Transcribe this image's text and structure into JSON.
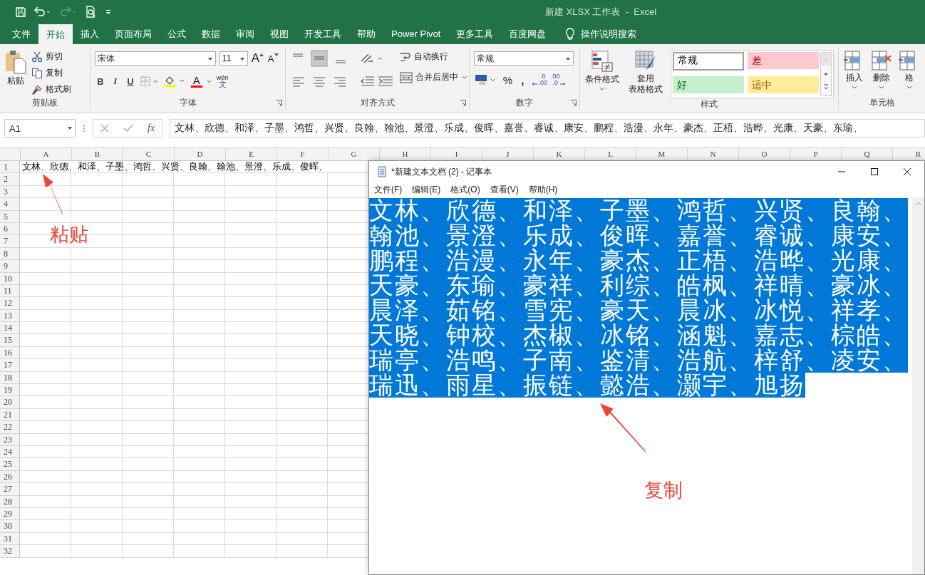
{
  "window": {
    "title": "新建 XLSX 工作表  -  Excel"
  },
  "ribbon_tabs": [
    {
      "label": "文件",
      "selected": false
    },
    {
      "label": "开始",
      "selected": true
    },
    {
      "label": "插入",
      "selected": false
    },
    {
      "label": "页面布局",
      "selected": false
    },
    {
      "label": "公式",
      "selected": false
    },
    {
      "label": "数据",
      "selected": false
    },
    {
      "label": "审阅",
      "selected": false
    },
    {
      "label": "视图",
      "selected": false
    },
    {
      "label": "开发工具",
      "selected": false
    },
    {
      "label": "帮助",
      "selected": false
    },
    {
      "label": "Power Pivot",
      "selected": false
    },
    {
      "label": "更多工具",
      "selected": false
    },
    {
      "label": "百度网盘",
      "selected": false
    }
  ],
  "tell_me": "操作说明搜索",
  "clipboard": {
    "paste": "粘贴",
    "items": [
      "剪切",
      "复制",
      "格式刷"
    ],
    "label": "剪贴板"
  },
  "font": {
    "name": "宋体",
    "size": "11",
    "grow": "A",
    "shrink": "A",
    "styles": [
      "B",
      "I",
      "U"
    ],
    "font_color": "A",
    "phonetic": [
      "wén",
      "文"
    ],
    "label": "字体"
  },
  "alignment": {
    "wrap": "自动换行",
    "merge": "合并后居中",
    "label": "对齐方式"
  },
  "number": {
    "format": "常规",
    "percent": "%",
    "comma": ",",
    "increase_decimal": [
      ".0",
      ".00"
    ],
    "decrease_decimal": [
      ".00",
      ".0"
    ],
    "label": "数字"
  },
  "styles": {
    "conditional": "条件格式",
    "table": [
      "套用",
      "表格格式"
    ],
    "cells": [
      {
        "text": "常规",
        "kind": "normal"
      },
      {
        "text": "差",
        "kind": "bad"
      },
      {
        "text": "好",
        "kind": "good"
      },
      {
        "text": "适中",
        "kind": "neutral"
      }
    ],
    "label": "样式"
  },
  "cells": {
    "buttons": [
      "插入",
      "删除",
      "格"
    ],
    "label": "单元格"
  },
  "name_box": "A1",
  "fx": "fx",
  "formula": "文林、欣德、和泽、子墨、鸿哲、兴贤、良翰、翰池、景澄、乐成、俊晖、嘉誉、睿诚、康安、鹏程、浩漫、永年、豪杰、正梧、浩晔、光康、天豪、东瑜、",
  "columns": [
    "A",
    "B",
    "C",
    "D",
    "E",
    "F",
    "G",
    "H",
    "I",
    "J",
    "K",
    "L",
    "M",
    "N",
    "O",
    "P",
    "Q",
    "R"
  ],
  "rows": [
    "1",
    "2",
    "3",
    "4",
    "5",
    "6",
    "7",
    "8",
    "9",
    "10",
    "11",
    "12",
    "13",
    "14",
    "15",
    "16",
    "17",
    "18",
    "19",
    "20",
    "21",
    "22",
    "23",
    "24",
    "25",
    "26",
    "27",
    "28",
    "29",
    "30",
    "31",
    "32"
  ],
  "cell_a1": "文林、欣德、和泽、子墨、鸿哲、兴贤、良翰、翰池、景澄、乐成、俊晖、",
  "notepad": {
    "title": "*新建文本文档 (2) - 记事本",
    "menu": [
      "文件(F)",
      "编辑(E)",
      "格式(O)",
      "查看(V)",
      "帮助(H)"
    ],
    "selected": true,
    "lines": [
      "文林、欣德、和泽、子墨、鸿哲、兴贤、良翰、",
      "翰池、景澄、乐成、俊晖、嘉誉、睿诚、康安、",
      "鹏程、浩漫、永年、豪杰、正梧、浩晔、光康、",
      "天豪、东瑜、豪祥、利综、皓枫、祥晴、豪冰、",
      "晨泽、茹铭、雪宪、豪天、晨冰、冰悦、祥孝、",
      "天晓、钟校、杰椒、冰铭、涵魁、嘉志、棕皓、",
      "瑞亭、浩鸣、子南、鉴清、浩航、梓舒、凌安、",
      "瑞迅、雨星、振链、懿浩、灏宇、旭扬"
    ]
  },
  "annotations": [
    "粘贴",
    "复制"
  ]
}
